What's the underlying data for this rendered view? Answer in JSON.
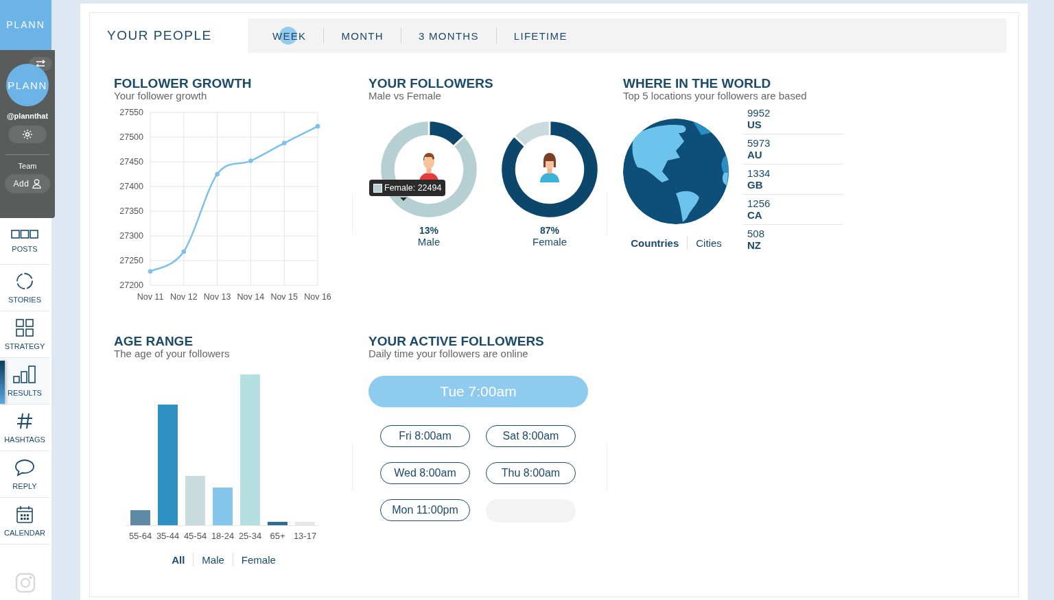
{
  "sidebar": {
    "brand": "PLANN",
    "account": {
      "avatar_text": "PLANN",
      "handle": "@plannthat"
    },
    "team": {
      "label": "Team",
      "add_button": "Add"
    },
    "nav": [
      {
        "label": "POSTS",
        "kind": "posts",
        "selected": false
      },
      {
        "label": "STORIES",
        "kind": "stories",
        "selected": false
      },
      {
        "label": "STRATEGY",
        "kind": "strategy",
        "selected": false
      },
      {
        "label": "RESULTS",
        "kind": "results",
        "selected": true
      },
      {
        "label": "HASHTAGS",
        "kind": "hashtags",
        "selected": false
      },
      {
        "label": "REPLY",
        "kind": "reply",
        "selected": false
      },
      {
        "label": "CALENDAR",
        "kind": "calendar",
        "selected": false
      }
    ]
  },
  "header": {
    "title": "YOUR PEOPLE",
    "tabs": [
      {
        "label": "WEEK",
        "selected": true
      },
      {
        "label": "MONTH",
        "selected": false
      },
      {
        "label": "3 MONTHS",
        "selected": false
      },
      {
        "label": "LIFETIME",
        "selected": false
      }
    ]
  },
  "follower_growth": {
    "title": "FOLLOWER GROWTH",
    "subtitle": "Your follower growth",
    "chart_data": {
      "type": "line",
      "categories": [
        "Nov 11",
        "Nov 12",
        "Nov 13",
        "Nov 14",
        "Nov 15",
        "Nov 16"
      ],
      "ylim": [
        27200,
        27550
      ],
      "yticks": [
        27200,
        27250,
        27300,
        27350,
        27400,
        27450,
        27500,
        27550
      ],
      "grid": true,
      "series": [
        {
          "color": "#7cc0ec",
          "marker": true,
          "values": [
            27228,
            27268,
            27425,
            27452,
            27488,
            27522
          ]
        }
      ]
    }
  },
  "your_followers": {
    "title": "YOUR FOLLOWERS",
    "subtitle": "Male vs Female",
    "tooltip": "Female: 22494",
    "donuts": [
      {
        "kind": "male",
        "percent": "13%",
        "label": "Male",
        "chart_data": {
          "type": "donut",
          "values": [
            13,
            87
          ]
        }
      },
      {
        "kind": "female",
        "percent": "87%",
        "label": "Female",
        "chart_data": {
          "type": "donut",
          "values": [
            87,
            13
          ]
        }
      }
    ]
  },
  "where_in_the_world": {
    "title": "WHERE IN THE WORLD",
    "subtitle": "Top 5 locations your followers are based",
    "toggle": [
      {
        "label": "Countries",
        "selected": true
      },
      {
        "label": "Cities",
        "selected": false
      }
    ],
    "locations": [
      {
        "count": "9952",
        "code": "US"
      },
      {
        "count": "5973",
        "code": "AU"
      },
      {
        "count": "1334",
        "code": "GB"
      },
      {
        "count": "1256",
        "code": "CA"
      },
      {
        "count": "508",
        "code": "NZ"
      }
    ]
  },
  "age_range": {
    "title": "AGE RANGE",
    "subtitle": "The age of your followers",
    "categories": [
      "55-64",
      "35-44",
      "45-54",
      "18-24",
      "25-34",
      "65+",
      "13-17"
    ],
    "filters": [
      {
        "label": "All",
        "selected": true
      },
      {
        "label": "Male",
        "selected": false
      },
      {
        "label": "Female",
        "selected": false
      }
    ]
  },
  "active_followers": {
    "title": "YOUR ACTIVE FOLLOWERS",
    "subtitle": "Daily time your followers are online",
    "peak": "Tue 7:00am",
    "times": [
      "Fri 8:00am",
      "Sat 8:00am",
      "Wed 8:00am",
      "Thu 8:00am",
      "Mon 11:00pm"
    ]
  }
}
